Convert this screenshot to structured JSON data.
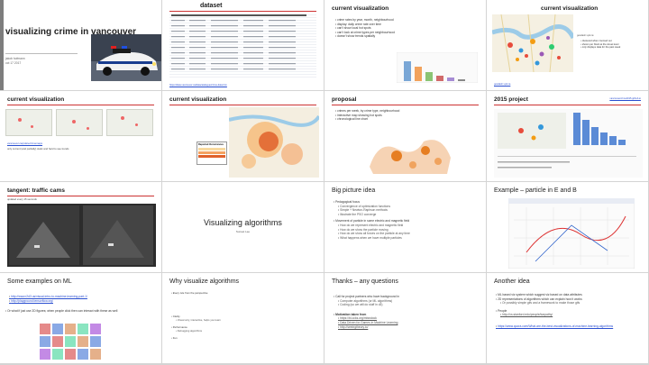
{
  "slides": {
    "s1": {
      "title": "visualizing crime in vancouver",
      "author": "jakob hofmann",
      "date": "oct 17 2017"
    },
    "s2": {
      "title": "dataset",
      "link": "https://data.vancouver.ca/datacatalogue/crime-data.htm"
    },
    "s3": {
      "title": "current visualization",
      "items": [
        "crime rates by year, month, neighbourhood",
        "display: daily crime rate over time",
        "can't show local hot spots",
        "can't look at crime types per neighbourhood",
        "doesn't show trends spatially"
      ]
    },
    "s4": {
      "title": "current visualization",
      "items": [
        "clustered when zoomed out",
        "shown per block at the street level",
        "only displays data for the past week"
      ],
      "caption": "geodash.vpd.ca"
    },
    "s5": {
      "title": "current visualization",
      "link": "vancouver.ca/police/crimemaps",
      "caption": "only current (and partially) static and hard to see trends"
    },
    "s6": {
      "title": "current visualization",
      "legend_title": "Reported Occurrences",
      "legend_levels": [
        "Low",
        "Medium",
        "High"
      ]
    },
    "s7": {
      "title": "proposal",
      "items": [
        "crimes per week, by crime type, neighbourhood",
        "interactive map showing hot spots",
        "chronological line chart"
      ]
    },
    "s8": {
      "title": "2015 project",
      "link": "vancouvercrime2015.github.io"
    },
    "s9": {
      "title": "tangent: traffic cams",
      "caption": "updated every 15 seconds"
    },
    "s10": {
      "title": "Visualizing algorithms",
      "subtitle": "Sunset Lee"
    },
    "s11": {
      "title": "Big picture idea",
      "items": [
        {
          "text": "Pedagogical focus",
          "sub": [
            "Convergence of optimization functions",
            "Simple + Newton-Raphson methods",
            "Illustrate the PSO converge"
          ]
        },
        {
          "text": "Movement of particle in some electric and magnetic field",
          "sub": [
            "How do we represent electric and magnetic field",
            "How do we show the particle moving",
            "How do we show all forces on the particle at any time",
            "What happens when we have multiple particles"
          ]
        }
      ]
    },
    "s12": {
      "title": "Example – particle in E and B"
    },
    "s13": {
      "title": "Some examples on ML",
      "links": [
        "http://www.r2d3.us/visual-intro-to-machine-learning-part-1/",
        "http://playground.tensorflow.org/"
      ],
      "text": "Or what if just use 2D figures; when people click then can interact with these as well"
    },
    "s14": {
      "title": "Why visualize algorithms",
      "items": [
        "Every rule from the perspective",
        "Clarity",
        "Visual only, interactive, helps you learn",
        "Performance",
        "Debugging algorithms",
        "Fun"
      ]
    },
    "s15": {
      "title": "Thanks – any questions",
      "items": [
        "Call for project partners who have background in",
        "Computer algorithms (or ML algorithms)",
        "Coding (so we will do stuff in d3)"
      ],
      "motivation": "Motivation taken from",
      "mlinks": [
        "https://bl.ocks.org/mbostock",
        "Data Driven for Games in Machine Learning",
        "http://seeingtheory.io/"
      ]
    },
    "s16": {
      "title": "Another idea",
      "items": [
        "ML based viz system which suggest viz based on data attributes",
        "2D representations of algorithms which can explain how it works",
        "Or possibly simple gifs and a framework to make those gifs",
        "People",
        "http://cs.stanford.edu/people/karpathy/",
        "https://www.quora.com/What-are-the-best-visualizations-of-machine-learning-algorithms"
      ]
    }
  }
}
